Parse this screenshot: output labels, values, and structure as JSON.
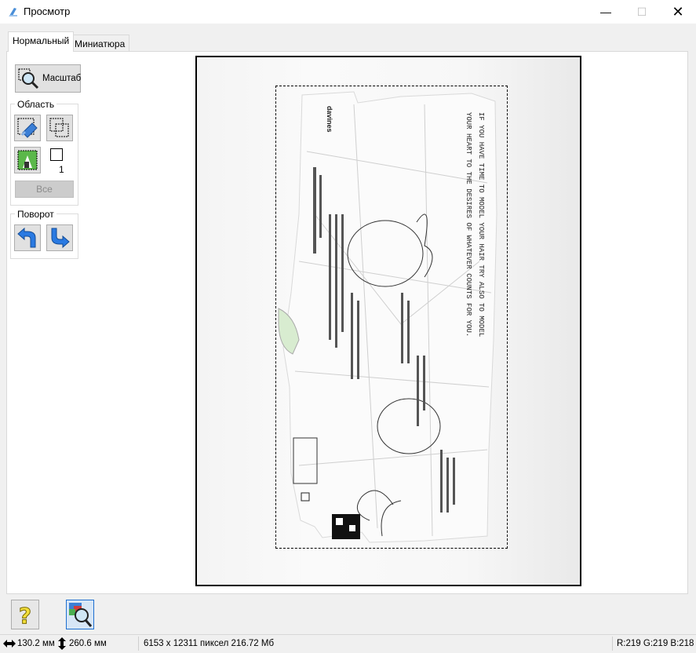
{
  "window": {
    "title": "Просмотр",
    "controls": {
      "minimize": "—",
      "maximize": "☐",
      "close": "✕"
    }
  },
  "tabs": [
    {
      "label": "Нормальный",
      "active": true
    },
    {
      "label": "Миниатюра",
      "active": false
    }
  ],
  "sidebar": {
    "zoom_button": "Масштаб",
    "area_group": {
      "title": "Область",
      "count": "1",
      "all_button": "Все"
    },
    "rotate_group": {
      "title": "Поворот"
    }
  },
  "status": {
    "width_value": "130.2 мм",
    "height_value": "260.6 мм",
    "image_info": "6153 x 12311 пиксел 216.72 Мб",
    "color": "R:219 G:219 B:218"
  },
  "icons": [
    "app-icon",
    "magnifier-icon",
    "auto-select-icon",
    "copy-frame-icon",
    "histogram-icon",
    "frame-outline-icon",
    "rotate-left-icon",
    "rotate-right-icon",
    "help-icon",
    "preview-scan-icon",
    "width-arrow-icon",
    "height-arrow-icon"
  ],
  "colors": {
    "accent": "#1e6fd0",
    "help_yellow": "#f2de3a",
    "button_face": "#e1e1e1"
  }
}
